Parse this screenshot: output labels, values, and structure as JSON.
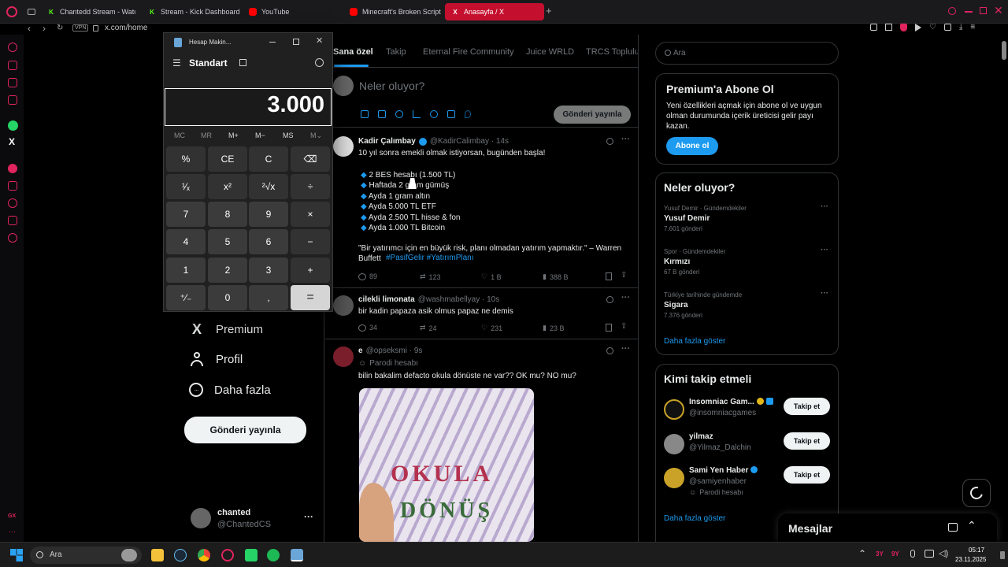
{
  "browser": {
    "tabs": [
      {
        "label": "Chantedd Stream - Watc",
        "icon": "kick-icon",
        "color": "#53fc18"
      },
      {
        "label": "Stream - Kick Dashboard",
        "icon": "kick-icon",
        "color": "#53fc18"
      },
      {
        "label": "YouTube",
        "icon": "youtube-icon",
        "color": "#ff0000"
      },
      {
        "label": "Minecraft's Broken Script",
        "icon": "youtube-icon",
        "color": "#ff0000"
      },
      {
        "label": "Anasayfa / X",
        "icon": "x-icon",
        "color": "#ffffff"
      }
    ],
    "vpn": "VPN",
    "url": "x.com/home"
  },
  "calculator": {
    "title": "Hesap Makin...",
    "mode": "Standart",
    "display": "3.000",
    "memory": [
      "MC",
      "MR",
      "M+",
      "M−",
      "MS",
      "M⌄"
    ],
    "keys": [
      "%",
      "CE",
      "C",
      "⌫",
      "¹⁄ₓ",
      "x²",
      "²√x",
      "÷",
      "7",
      "8",
      "9",
      "×",
      "4",
      "5",
      "6",
      "−",
      "1",
      "2",
      "3",
      "+",
      "⁺⁄₋",
      "0",
      ",",
      "="
    ]
  },
  "left_nav": {
    "items": [
      "Premium",
      "Profil",
      "Daha fazla"
    ],
    "post_button": "Gönderi yayınla",
    "account_name": "chanted",
    "account_handle": "@ChantedCS",
    "more": "···"
  },
  "feed": {
    "tabs": [
      "Sana özel",
      "Takip",
      "Eternal Fire Community",
      "Juice WRLD",
      "TRCS Topluluk"
    ],
    "compose_placeholder": "Neler oluyor?",
    "compose_button": "Gönderi yayınla",
    "tweets": [
      {
        "name": "Kadir Çalımbay",
        "handle": "@KadirCalimbay · 14s",
        "text": "10 yıl sonra emekli olmak istiyorsan, bugünden başla!",
        "bullets": [
          "2 BES hesabı (1.500 TL)",
          "Haftada 2 gram gümüş",
          "Ayda 1 gram altın",
          "Ayda 5.000 TL ETF",
          "Ayda 2.500 TL hisse & fon",
          "Ayda 1.000 TL Bitcoin"
        ],
        "quote": "\"Bir yatırımcı için en büyük risk, planı olmadan yatırım yapmaktır.\" – Warren Buffett",
        "hashtags": "#PasifGelir #YatırımPlanı",
        "stats": [
          "89",
          "123",
          "1 B",
          "388 B"
        ]
      },
      {
        "name": "cilekli limonata",
        "handle": "@washmabellyay · 10s",
        "text": "bir kadin papaza asik olmus papaz ne demis",
        "stats": [
          "34",
          "24",
          "231",
          "23 B"
        ]
      },
      {
        "name": "e",
        "handle": "@opseksmi · 9s",
        "badge": "Parodi hesabı",
        "text": "bilin bakalim defacto okula dönüste ne var?? OK mu? NO mu?",
        "image_text": [
          "OKULA",
          "DÖNÜŞ"
        ]
      }
    ]
  },
  "right": {
    "search_placeholder": "Ara",
    "premium": {
      "title": "Premium'a Abone Ol",
      "text": "Yeni özellikleri açmak için abone ol ve uygun olman durumunda içerik üreticisi gelir payı kazan.",
      "button": "Abone ol"
    },
    "trends": {
      "title": "Neler oluyor?",
      "items": [
        {
          "context": "Yusuf Demir · Gündemdekiler",
          "name": "Yusuf Demir",
          "count": "7.601 gönderi"
        },
        {
          "context": "Spor · Gündemdekiler",
          "name": "Kırmızı",
          "count": "67 B gönderi"
        },
        {
          "context": "Türkiye tarihinde gündemde",
          "name": "Sigara",
          "count": "7.376 gönderi"
        }
      ],
      "more": "Daha fazla göster"
    },
    "follow": {
      "title": "Kimi takip etmeli",
      "items": [
        {
          "name": "Insomniac Gam...",
          "handle": "@insomniacgames",
          "button": "Takip et"
        },
        {
          "name": "yilmaz",
          "handle": "@Yilmaz_Dalchin",
          "button": "Takip et"
        },
        {
          "name": "Sami Yen Haber",
          "handle": "@samiyenhaber",
          "sub": "Parodi hesabı",
          "button": "Takip et"
        }
      ],
      "more": "Daha fazla göster"
    },
    "messages": "Mesajlar"
  },
  "taskbar": {
    "search": "Ara",
    "tray_a": "3Y",
    "tray_b": "9Y",
    "time": "05:17",
    "date": "23.11.2025"
  }
}
